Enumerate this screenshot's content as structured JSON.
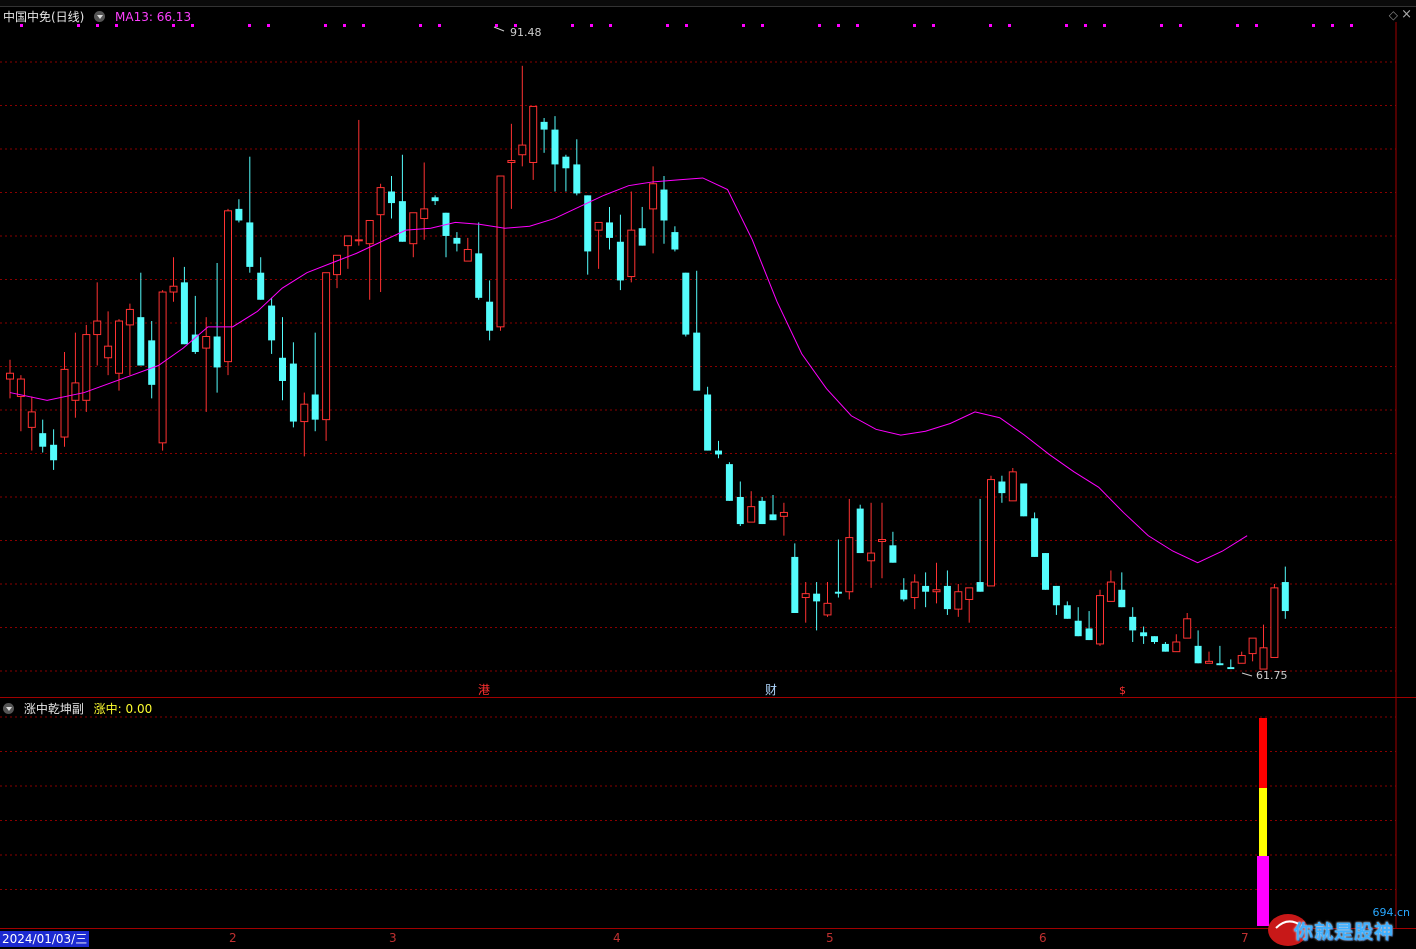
{
  "main_legend": {
    "stock_name": "中国中免(日线)",
    "ma_label": "MA13: 66.13"
  },
  "sub_legend": {
    "indicator_name": "涨中乾坤副",
    "value_label": "涨中: 0.00"
  },
  "annotations": {
    "high_label": "91.48",
    "low_label": "61.75",
    "events": [
      "港",
      "财",
      "$"
    ]
  },
  "time_axis": {
    "start_date": "2024/01/03/三",
    "months": [
      "2",
      "3",
      "4",
      "5",
      "6",
      "7"
    ]
  },
  "watermark": {
    "url": "694.cn",
    "text": "你就是股神"
  },
  "colors": {
    "up": "#ff3232",
    "down": "#54fcfc",
    "ma": "#ff00ff",
    "grid": "#8a0000",
    "panel_border": "#a00000",
    "bar_red": "#ff0000",
    "bar_yellow": "#ffff00",
    "bar_magenta": "#ff00ff"
  },
  "chart_data": {
    "type": "candlestick",
    "y_range": [
      60.2,
      93.3
    ],
    "candles": [
      [
        75.3,
        76.3,
        74.3,
        75.6
      ],
      [
        74.4,
        75.5,
        72.6,
        75.3
      ],
      [
        72.8,
        74.4,
        71.6,
        73.6
      ],
      [
        72.5,
        73.2,
        71.5,
        71.8
      ],
      [
        71.9,
        72.7,
        70.6,
        71.1
      ],
      [
        72.3,
        76.7,
        71.8,
        75.8
      ],
      [
        74.2,
        77.7,
        73.3,
        75.1
      ],
      [
        74.2,
        78.1,
        73.6,
        77.6
      ],
      [
        77.6,
        80.3,
        76.0,
        78.3
      ],
      [
        76.4,
        78.8,
        75.5,
        77.0
      ],
      [
        75.6,
        78.4,
        74.7,
        78.3
      ],
      [
        78.1,
        79.2,
        75.5,
        78.9
      ],
      [
        78.5,
        80.8,
        77.6,
        76.0
      ],
      [
        77.3,
        78.3,
        74.3,
        75.0
      ],
      [
        72.0,
        79.9,
        71.6,
        79.8
      ],
      [
        79.8,
        81.6,
        79.3,
        80.1
      ],
      [
        80.3,
        81.1,
        77.6,
        77.1
      ],
      [
        77.6,
        79.6,
        76.6,
        76.7
      ],
      [
        76.9,
        78.5,
        73.6,
        77.5
      ],
      [
        77.5,
        81.3,
        74.6,
        75.9
      ],
      [
        76.2,
        84.1,
        75.5,
        84.0
      ],
      [
        84.1,
        84.6,
        83.4,
        83.5
      ],
      [
        83.4,
        86.8,
        80.8,
        81.1
      ],
      [
        80.8,
        81.6,
        79.4,
        79.4
      ],
      [
        79.1,
        79.5,
        76.6,
        77.3
      ],
      [
        76.4,
        78.5,
        74.2,
        75.2
      ],
      [
        76.1,
        77.2,
        72.8,
        73.1
      ],
      [
        73.1,
        74.6,
        71.3,
        74.0
      ],
      [
        74.5,
        77.7,
        72.6,
        73.2
      ],
      [
        73.2,
        77.3,
        72.1,
        80.8
      ],
      [
        80.7,
        81.6,
        80.0,
        81.7
      ],
      [
        82.2,
        82.4,
        81.0,
        82.7
      ],
      [
        82.5,
        88.7,
        82.2,
        82.5
      ],
      [
        82.3,
        82.8,
        79.4,
        83.5
      ],
      [
        83.8,
        85.4,
        79.8,
        85.2
      ],
      [
        85.0,
        85.8,
        83.6,
        84.4
      ],
      [
        84.5,
        86.9,
        82.6,
        82.4
      ],
      [
        82.3,
        83.8,
        81.6,
        83.9
      ],
      [
        83.6,
        86.5,
        82.5,
        84.1
      ],
      [
        84.7,
        84.8,
        84.3,
        84.5
      ],
      [
        83.9,
        83.9,
        81.6,
        82.7
      ],
      [
        82.6,
        82.9,
        81.9,
        82.3
      ],
      [
        81.4,
        82.6,
        81.6,
        82.0
      ],
      [
        81.8,
        83.4,
        79.4,
        79.5
      ],
      [
        79.3,
        80.4,
        77.3,
        77.8
      ],
      [
        78.0,
        81.2,
        77.8,
        85.8
      ],
      [
        86.5,
        88.5,
        84.1,
        86.6
      ],
      [
        86.9,
        91.5,
        86.3,
        87.4
      ],
      [
        86.5,
        88.3,
        85.6,
        89.4
      ],
      [
        88.6,
        88.8,
        87.0,
        88.2
      ],
      [
        88.2,
        88.9,
        85.0,
        86.4
      ],
      [
        86.8,
        86.9,
        85.0,
        86.2
      ],
      [
        86.4,
        87.7,
        84.8,
        84.9
      ],
      [
        84.8,
        84.8,
        80.7,
        81.9
      ],
      [
        83.0,
        83.4,
        81.0,
        83.4
      ],
      [
        83.4,
        84.2,
        82.0,
        82.6
      ],
      [
        82.4,
        83.8,
        79.9,
        80.4
      ],
      [
        80.6,
        85.0,
        80.3,
        83.0
      ],
      [
        83.1,
        84.2,
        82.8,
        82.2
      ],
      [
        84.1,
        86.3,
        81.8,
        85.4
      ],
      [
        85.1,
        85.8,
        82.3,
        83.5
      ],
      [
        82.9,
        83.2,
        81.9,
        82.0
      ],
      [
        80.8,
        80.8,
        77.5,
        77.6
      ],
      [
        77.7,
        80.9,
        74.7,
        74.7
      ],
      [
        74.5,
        74.9,
        71.6,
        71.6
      ],
      [
        71.6,
        72.1,
        71.2,
        71.4
      ],
      [
        70.9,
        71.0,
        69.0,
        69.0
      ],
      [
        69.2,
        70.0,
        67.7,
        67.8
      ],
      [
        67.9,
        69.5,
        67.9,
        68.7
      ],
      [
        69.0,
        69.2,
        67.8,
        67.8
      ],
      [
        68.3,
        69.3,
        68.0,
        68.0
      ],
      [
        68.2,
        68.9,
        67.2,
        68.4
      ],
      [
        66.1,
        66.8,
        63.2,
        63.2
      ],
      [
        64.0,
        64.8,
        62.7,
        64.2
      ],
      [
        64.2,
        64.8,
        62.3,
        63.8
      ],
      [
        63.1,
        64.8,
        63.0,
        63.7
      ],
      [
        64.3,
        67.0,
        64.0,
        64.2
      ],
      [
        64.3,
        69.1,
        63.9,
        67.1
      ],
      [
        68.6,
        68.8,
        67.2,
        66.3
      ],
      [
        65.9,
        68.9,
        64.5,
        66.3
      ],
      [
        66.9,
        68.9,
        65.0,
        67.0
      ],
      [
        66.7,
        67.4,
        66.3,
        65.8
      ],
      [
        64.4,
        65.0,
        63.8,
        63.9
      ],
      [
        64.0,
        65.2,
        63.4,
        64.8
      ],
      [
        64.6,
        65.3,
        63.5,
        64.3
      ],
      [
        64.3,
        65.8,
        63.7,
        64.4
      ],
      [
        64.6,
        65.4,
        63.1,
        63.4
      ],
      [
        63.4,
        64.7,
        63.0,
        64.3
      ],
      [
        63.9,
        64.5,
        62.7,
        64.5
      ],
      [
        64.8,
        69.1,
        64.5,
        64.3
      ],
      [
        64.6,
        70.3,
        66.3,
        70.1
      ],
      [
        70.0,
        70.3,
        68.9,
        69.4
      ],
      [
        69.0,
        70.7,
        69.0,
        70.5
      ],
      [
        69.9,
        69.7,
        68.3,
        68.2
      ],
      [
        68.1,
        68.4,
        66.2,
        66.1
      ],
      [
        66.3,
        66.2,
        65.1,
        64.4
      ],
      [
        64.6,
        64.6,
        63.1,
        63.6
      ],
      [
        63.6,
        63.8,
        63.0,
        62.9
      ],
      [
        62.8,
        63.5,
        62.0,
        62.0
      ],
      [
        62.4,
        63.3,
        62.0,
        61.8
      ],
      [
        61.6,
        64.4,
        61.5,
        64.1
      ],
      [
        63.8,
        65.4,
        63.8,
        64.8
      ],
      [
        64.4,
        65.3,
        64.3,
        63.5
      ],
      [
        63.0,
        63.5,
        61.7,
        62.3
      ],
      [
        62.2,
        62.5,
        61.6,
        62.0
      ],
      [
        62.0,
        61.5,
        61.6,
        61.7
      ],
      [
        61.6,
        61.7,
        61.4,
        61.2
      ],
      [
        61.2,
        62.1,
        61.4,
        61.7
      ],
      [
        61.9,
        63.2,
        61.9,
        62.9
      ],
      [
        61.5,
        62.3,
        61.2,
        60.6
      ],
      [
        60.6,
        61.2,
        61.1,
        60.7
      ],
      [
        60.6,
        61.5,
        60.5,
        60.5
      ],
      [
        60.4,
        60.8,
        60.3,
        60.3
      ],
      [
        60.6,
        61.2,
        61.0,
        61.0
      ],
      [
        61.1,
        61.9,
        60.7,
        61.9
      ],
      [
        60.3,
        62.6,
        61.1,
        61.4
      ],
      [
        60.9,
        64.7,
        62.5,
        64.5
      ],
      [
        64.8,
        65.6,
        62.9,
        63.3
      ]
    ],
    "ma13": [
      [
        0,
        74.6
      ],
      [
        3,
        74.2
      ],
      [
        6,
        74.6
      ],
      [
        9,
        75.3
      ],
      [
        12,
        76.0
      ],
      [
        14,
        76.9
      ],
      [
        16,
        78.0
      ],
      [
        18,
        78.0
      ],
      [
        20,
        78.8
      ],
      [
        22,
        80.0
      ],
      [
        24,
        80.8
      ],
      [
        26,
        81.3
      ],
      [
        28,
        81.8
      ],
      [
        30,
        82.4
      ],
      [
        32,
        83.0
      ],
      [
        34,
        83.1
      ],
      [
        36,
        83.4
      ],
      [
        38,
        83.3
      ],
      [
        40,
        83.1
      ],
      [
        42,
        83.2
      ],
      [
        44,
        83.6
      ],
      [
        46,
        84.2
      ],
      [
        48,
        84.8
      ],
      [
        50,
        85.3
      ],
      [
        52,
        85.5
      ],
      [
        54,
        85.6
      ],
      [
        56,
        85.7
      ],
      [
        58,
        85.1
      ],
      [
        60,
        82.5
      ],
      [
        62,
        79.3
      ],
      [
        64,
        76.6
      ],
      [
        66,
        74.8
      ],
      [
        68,
        73.4
      ],
      [
        70,
        72.7
      ],
      [
        72,
        72.4
      ],
      [
        74,
        72.6
      ],
      [
        76,
        73.0
      ],
      [
        78,
        73.6
      ],
      [
        80,
        73.3
      ],
      [
        82,
        72.4
      ],
      [
        84,
        71.4
      ],
      [
        86,
        70.5
      ],
      [
        88,
        69.7
      ],
      [
        90,
        68.4
      ],
      [
        92,
        67.2
      ],
      [
        94,
        66.4
      ],
      [
        96,
        65.8
      ],
      [
        98,
        66.4
      ],
      [
        100,
        67.2
      ]
    ]
  }
}
